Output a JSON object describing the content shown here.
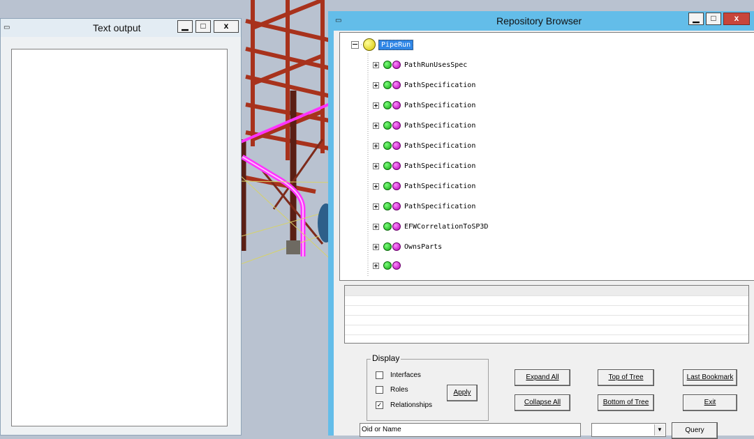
{
  "text_output": {
    "title": "Text output",
    "controls": {
      "minimize": "▁",
      "maximize": "□",
      "close": "x"
    }
  },
  "repository_browser": {
    "title": "Repository Browser",
    "controls": {
      "minimize": "▁",
      "maximize": "□",
      "close": "x"
    },
    "tree": {
      "root": "PipeRun",
      "children": [
        "PathRunUsesSpec",
        "PathSpecification",
        "PathSpecification",
        "PathSpecification",
        "PathSpecification",
        "PathSpecification",
        "PathSpecification",
        "PathSpecification",
        "EFWCorrelationToSP3D",
        "OwnsParts"
      ]
    },
    "display": {
      "legend": "Display",
      "interfaces": {
        "label": "Interfaces",
        "checked": false
      },
      "roles": {
        "label": "Roles",
        "checked": false
      },
      "relationships": {
        "label": "Relationships",
        "checked": true
      },
      "apply": "Apply"
    },
    "buttons": {
      "expand_all": "Expand All",
      "collapse_all": "Collapse All",
      "top_of_tree": "Top of Tree",
      "bottom_of_tree": "Bottom of Tree",
      "last_bookmark": "Last Bookmark",
      "exit": "Exit",
      "query": "Query"
    },
    "search": {
      "value": "Oid or Name"
    },
    "combo": {
      "value": "",
      "arrow": "▼"
    }
  },
  "colors": {
    "titlebar_active": "#63bde9",
    "selection": "#2f86e6",
    "pipe_magenta": "#ff33ff",
    "structure_red": "#a8321c"
  }
}
